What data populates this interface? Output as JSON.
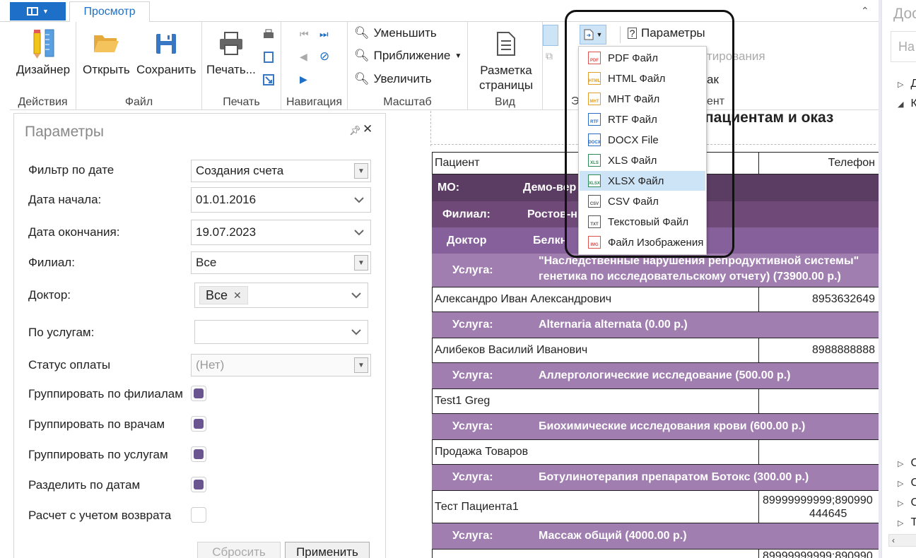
{
  "ribbon": {
    "tab_view": "Просмотр",
    "groups": {
      "actions": {
        "label": "Действия",
        "designer": "Дизайнер"
      },
      "file": {
        "label": "Файл",
        "open": "Открыть",
        "save": "Сохранить"
      },
      "print": {
        "label": "Печать",
        "print_btn": "Печать..."
      },
      "navigation": {
        "label": "Навигация"
      },
      "zoom": {
        "label": "Масштаб",
        "zoom_out": "Уменьшить",
        "zoom": "Приближение",
        "zoom_in": "Увеличить"
      },
      "view": {
        "label": "Вид",
        "layout_line1": "Разметка",
        "layout_line2": "страницы"
      },
      "export": {
        "label_fragment": "Э",
        "parameters": "Параметры",
        "faded_fragment": "тирования",
        "tail_fragment1": "ак",
        "tail_fragment2": "ент"
      }
    }
  },
  "export_menu": {
    "items": [
      {
        "label": "PDF Файл",
        "icon": "PDF",
        "color": "#d9534f"
      },
      {
        "label": "HTML Файл",
        "icon": "HTML",
        "color": "#e0a030"
      },
      {
        "label": "MHT Файл",
        "icon": "MHT",
        "color": "#e0a030"
      },
      {
        "label": "RTF Файл",
        "icon": "RTF",
        "color": "#2b6cc4"
      },
      {
        "label": "DOCX File",
        "icon": "DOCX",
        "color": "#2b6cc4"
      },
      {
        "label": "XLS Файл",
        "icon": "XLS",
        "color": "#2e8b57"
      },
      {
        "label": "XLSX Файл",
        "icon": "XLSX",
        "color": "#2e8b57"
      },
      {
        "label": "CSV Файл",
        "icon": "CSV",
        "color": "#555555"
      },
      {
        "label": "Текстовый Файл",
        "icon": "TXT",
        "color": "#555555"
      },
      {
        "label": "Файл Изображения",
        "icon": "IMG",
        "color": "#d9534f"
      }
    ],
    "active_index": 6
  },
  "params": {
    "title": "Параметры",
    "date_filter": {
      "label": "Фильтр по дате",
      "value": "Создания счета"
    },
    "date_start": {
      "label": "Дата начала:",
      "value": "01.01.2016"
    },
    "date_end": {
      "label": "Дата окончания:",
      "value": "19.07.2023"
    },
    "branch": {
      "label": "Филиал:",
      "value": "Все"
    },
    "doctor": {
      "label": "Доктор:",
      "tag": "Все"
    },
    "services": {
      "label": "По услугам:",
      "value": ""
    },
    "payment_status": {
      "label": "Статус оплаты",
      "placeholder": "(Нет)"
    },
    "group_branches": {
      "label": "Группировать по филиалам",
      "checked": true
    },
    "group_doctors": {
      "label": "Группировать по врачам",
      "checked": true
    },
    "group_services": {
      "label": "Группировать по услугам",
      "checked": true
    },
    "split_dates": {
      "label": "Разделить по датам",
      "checked": true
    },
    "refund_calc": {
      "label": "Расчет с учетом возврата",
      "checked": false
    },
    "reset_label": "Сбросить",
    "apply_label": "Применить"
  },
  "report": {
    "title_fragment": "пациентам и оказ",
    "header": {
      "patient": "Пациент",
      "phone": "Телефон"
    },
    "mo": {
      "key": "МО:",
      "value": "Демо-вер"
    },
    "branch": {
      "key": "Филиал:",
      "value": "Ростов-н"
    },
    "doctor": {
      "key": "Доктор",
      "value": "Белкн"
    },
    "service1": {
      "key": "Услуга:",
      "line1": "\"Наследственные нарушения репродуктивной системы\"",
      "line2": "генетика по исследовательскому отчету) (73900.00 р.)"
    },
    "patient1": {
      "name": "Александро Иван Александрович",
      "phone": "8953632649"
    },
    "service2": {
      "key": "Услуга:",
      "value": "Alternaria alternata (0.00 р.)"
    },
    "patient2": {
      "name": "Алибеков Василий Иванович",
      "phone": "8988888888"
    },
    "service3": {
      "key": "Услуга:",
      "value": "Аллергологические исследование (500.00 р.)"
    },
    "patient3": {
      "name": "Test1 Greg",
      "phone": ""
    },
    "service4": {
      "key": "Услуга:",
      "value": "Биохимические исследования крови (600.00 р.)"
    },
    "patient4": {
      "name": "Продажа  Товаров",
      "phone": ""
    },
    "service5": {
      "key": "Услуга:",
      "value": "Ботулинотерапия препаратом Ботокс (300.00 р.)"
    },
    "patient5": {
      "name": "Тест Пациента1",
      "phone_line1": "89999999999;890990",
      "phone_line2": "444645"
    },
    "service6": {
      "key": "Услуга:",
      "value": "Массаж общий (4000.00 р.)"
    },
    "patient6": {
      "phone": "89999999999;890990"
    }
  },
  "right_panel": {
    "title": "Доc",
    "search_placeholder": "На",
    "nodes_top": [
      "Д",
      "К"
    ],
    "nodes_bottom": [
      "С",
      "С",
      "С",
      "Т"
    ]
  }
}
